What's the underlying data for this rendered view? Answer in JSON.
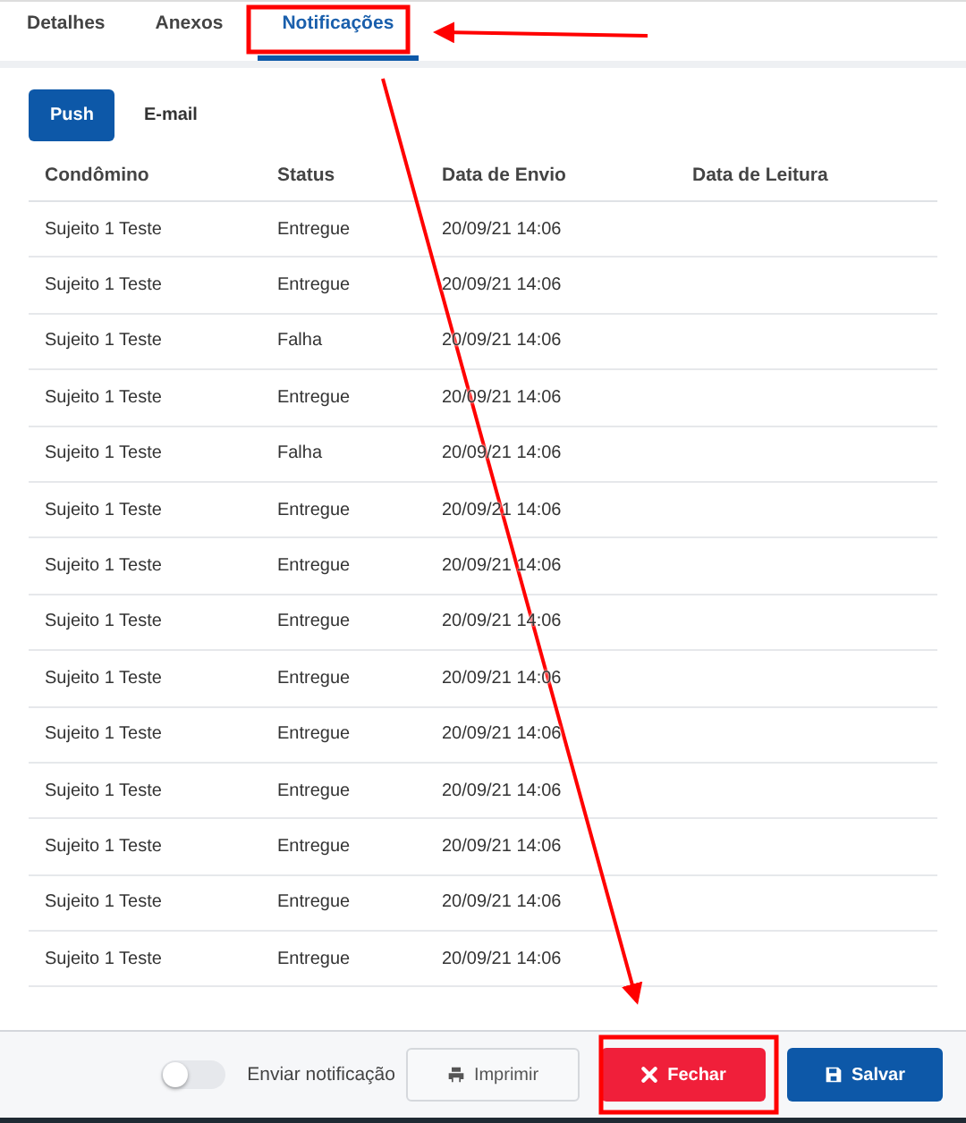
{
  "tabs": [
    {
      "label": "Detalhes",
      "selected": false
    },
    {
      "label": "Anexos",
      "selected": false
    },
    {
      "label": "Notificações",
      "selected": true
    }
  ],
  "channels": [
    {
      "label": "Push",
      "selected": true
    },
    {
      "label": "E-mail",
      "selected": false
    }
  ],
  "table": {
    "columns": [
      "Condômino",
      "Status",
      "Data de Envio",
      "Data de Leitura"
    ],
    "rows": [
      [
        "Sujeito 1 Teste",
        "Entregue",
        "20/09/21 14:06"
      ],
      [
        "Sujeito 1 Teste",
        "Entregue",
        "20/09/21 14:06"
      ],
      [
        "Sujeito 1 Teste",
        "Falha",
        "20/09/21 14:06"
      ],
      [
        "Sujeito 1 Teste",
        "Entregue",
        "20/09/21 14:06"
      ],
      [
        "Sujeito 1 Teste",
        "Falha",
        "20/09/21 14:06"
      ],
      [
        "Sujeito 1 Teste",
        "Entregue",
        "20/09/21 14:06"
      ],
      [
        "Sujeito 1 Teste",
        "Entregue",
        "20/09/21 14:06"
      ],
      [
        "Sujeito 1 Teste",
        "Entregue",
        "20/09/21 14:06"
      ],
      [
        "Sujeito 1 Teste",
        "Entregue",
        "20/09/21 14:06"
      ],
      [
        "Sujeito 1 Teste",
        "Entregue",
        "20/09/21 14:06"
      ],
      [
        "Sujeito 1 Teste",
        "Entregue",
        "20/09/21 14:06"
      ],
      [
        "Sujeito 1 Teste",
        "Entregue",
        "20/09/21 14:06"
      ],
      [
        "Sujeito 1 Teste",
        "Entregue",
        "20/09/21 14:06"
      ],
      [
        "Sujeito 1 Teste",
        "Entregue",
        "20/09/21 14:06"
      ]
    ]
  },
  "footer": {
    "toggle": {
      "label": "Enviar notificação",
      "on": false
    },
    "buttons": [
      {
        "kind": "print",
        "label": "Imprimir"
      },
      {
        "kind": "close",
        "label": "Fechar"
      },
      {
        "kind": "save",
        "label": "Salvar"
      }
    ]
  }
}
